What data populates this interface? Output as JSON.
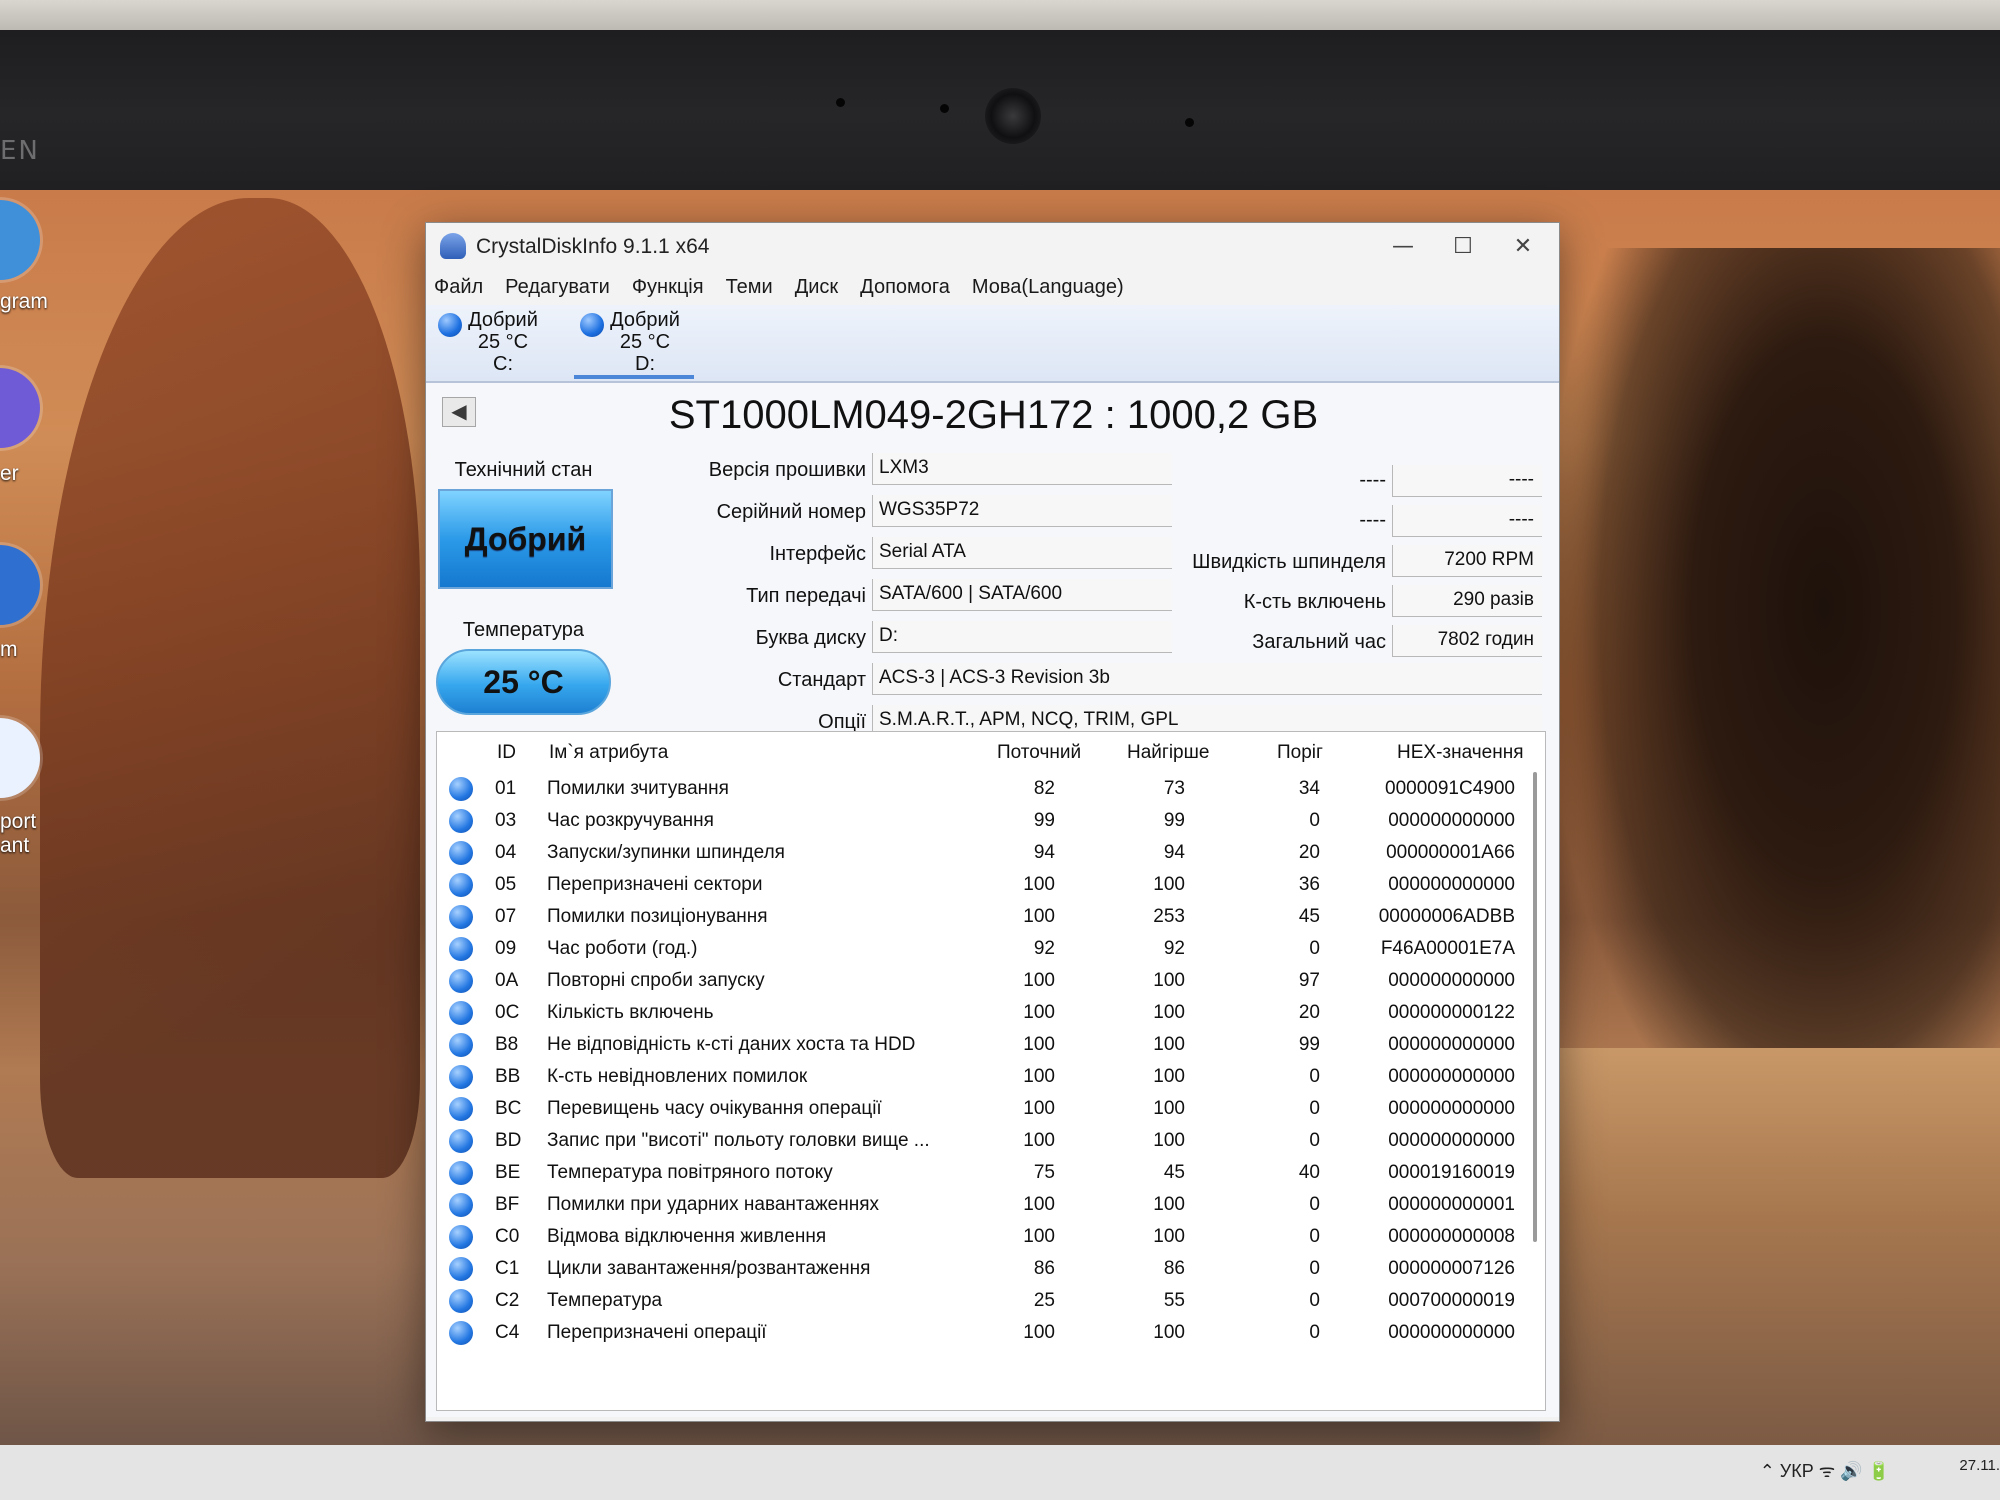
{
  "laptop": {
    "brand": "EN"
  },
  "desktop_icons": [
    {
      "label": "gram",
      "icon": "telegram-icon"
    },
    {
      "label": "er",
      "icon": "viber-icon"
    },
    {
      "label": "m",
      "icon": "app-icon"
    },
    {
      "label": "port\nant",
      "icon": "support-assistant-icon"
    }
  ],
  "window": {
    "title": "CrystalDiskInfo 9.1.1 x64",
    "controls": {
      "minimize": "—",
      "maximize": "☐",
      "close": "✕"
    },
    "menu": [
      "Файл",
      "Редагувати",
      "Функція",
      "Теми",
      "Диск",
      "Допомога",
      "Мова(Language)"
    ],
    "disk_tabs": [
      {
        "status": "Добрий",
        "temp": "25 °C",
        "letter": "C:"
      },
      {
        "status": "Добрий",
        "temp": "25 °C",
        "letter": "D:"
      }
    ],
    "model": "ST1000LM049-2GH172 : 1000,2 GB",
    "health": {
      "label": "Технічний стан",
      "value": "Добрий",
      "color": "#2c9ae8"
    },
    "temperature": {
      "label": "Температура",
      "value": "25 °C",
      "color": "#36a7ee"
    },
    "fields": {
      "firmware": {
        "label": "Версія прошивки",
        "value": "LXM3"
      },
      "serial": {
        "label": "Серійний номер",
        "value": "WGS35P72"
      },
      "interface": {
        "label": "Інтерфейс",
        "value": "Serial ATA"
      },
      "transfer": {
        "label": "Тип передачі",
        "value": "SATA/600 | SATA/600"
      },
      "drive_letter": {
        "label": "Буква диску",
        "value": "D:"
      },
      "standard": {
        "label": "Стандарт",
        "value": "ACS-3 | ACS-3 Revision 3b"
      },
      "options": {
        "label": "Опції",
        "value": "S.M.A.R.T., APM, NCQ, TRIM, GPL"
      }
    },
    "right_fields": {
      "blank1": {
        "label": "----",
        "value": "----"
      },
      "blank2": {
        "label": "----",
        "value": "----"
      },
      "rpm": {
        "label": "Швидкість шпинделя",
        "value": "7200 RPM"
      },
      "power_count": {
        "label": "К-сть включень",
        "value": "290 разів"
      },
      "power_hours": {
        "label": "Загальний час",
        "value": "7802 годин"
      }
    },
    "smart": {
      "headers": {
        "id": "ID",
        "name": "Ім`я атрибута",
        "current": "Поточний",
        "worst": "Найгірше",
        "threshold": "Поріг",
        "raw": "HEX-значення"
      },
      "rows": [
        {
          "id": "01",
          "name": "Помилки зчитування",
          "current": "82",
          "worst": "73",
          "threshold": "34",
          "raw": "0000091C4900"
        },
        {
          "id": "03",
          "name": "Час розкручування",
          "current": "99",
          "worst": "99",
          "threshold": "0",
          "raw": "000000000000"
        },
        {
          "id": "04",
          "name": "Запуски/зупинки шпинделя",
          "current": "94",
          "worst": "94",
          "threshold": "20",
          "raw": "000000001A66"
        },
        {
          "id": "05",
          "name": "Перепризначені сектори",
          "current": "100",
          "worst": "100",
          "threshold": "36",
          "raw": "000000000000"
        },
        {
          "id": "07",
          "name": "Помилки позиціонування",
          "current": "100",
          "worst": "253",
          "threshold": "45",
          "raw": "00000006ADBB"
        },
        {
          "id": "09",
          "name": "Час роботи (год.)",
          "current": "92",
          "worst": "92",
          "threshold": "0",
          "raw": "F46A00001E7A"
        },
        {
          "id": "0A",
          "name": "Повторні спроби запуску",
          "current": "100",
          "worst": "100",
          "threshold": "97",
          "raw": "000000000000"
        },
        {
          "id": "0C",
          "name": "Кількість включень",
          "current": "100",
          "worst": "100",
          "threshold": "20",
          "raw": "000000000122"
        },
        {
          "id": "B8",
          "name": "Не відповідність к-сті даних хоста та HDD",
          "current": "100",
          "worst": "100",
          "threshold": "99",
          "raw": "000000000000"
        },
        {
          "id": "BB",
          "name": "К-сть невідновлених помилок",
          "current": "100",
          "worst": "100",
          "threshold": "0",
          "raw": "000000000000"
        },
        {
          "id": "BC",
          "name": "Перевищень часу очікування операції",
          "current": "100",
          "worst": "100",
          "threshold": "0",
          "raw": "000000000000"
        },
        {
          "id": "BD",
          "name": "Запис при \"висоті\" польоту головки вище ...",
          "current": "100",
          "worst": "100",
          "threshold": "0",
          "raw": "000000000000"
        },
        {
          "id": "BE",
          "name": "Температура повітряного потоку",
          "current": "75",
          "worst": "45",
          "threshold": "40",
          "raw": "000019160019"
        },
        {
          "id": "BF",
          "name": "Помилки при ударних навантаженнях",
          "current": "100",
          "worst": "100",
          "threshold": "0",
          "raw": "000000000001"
        },
        {
          "id": "C0",
          "name": "Відмова відключення живлення",
          "current": "100",
          "worst": "100",
          "threshold": "0",
          "raw": "000000000008"
        },
        {
          "id": "C1",
          "name": "Цикли завантаження/розвантаження",
          "current": "86",
          "worst": "86",
          "threshold": "0",
          "raw": "000000007126"
        },
        {
          "id": "C2",
          "name": "Температура",
          "current": "25",
          "worst": "55",
          "threshold": "0",
          "raw": "000700000019"
        },
        {
          "id": "C4",
          "name": "Перепризначені операції",
          "current": "100",
          "worst": "100",
          "threshold": "0",
          "raw": "000000000000"
        }
      ]
    }
  },
  "taskbar": {
    "language": "УКР",
    "tray": "⌃   УКР   ᯤ  🔊  🔋",
    "date": "27.11."
  }
}
